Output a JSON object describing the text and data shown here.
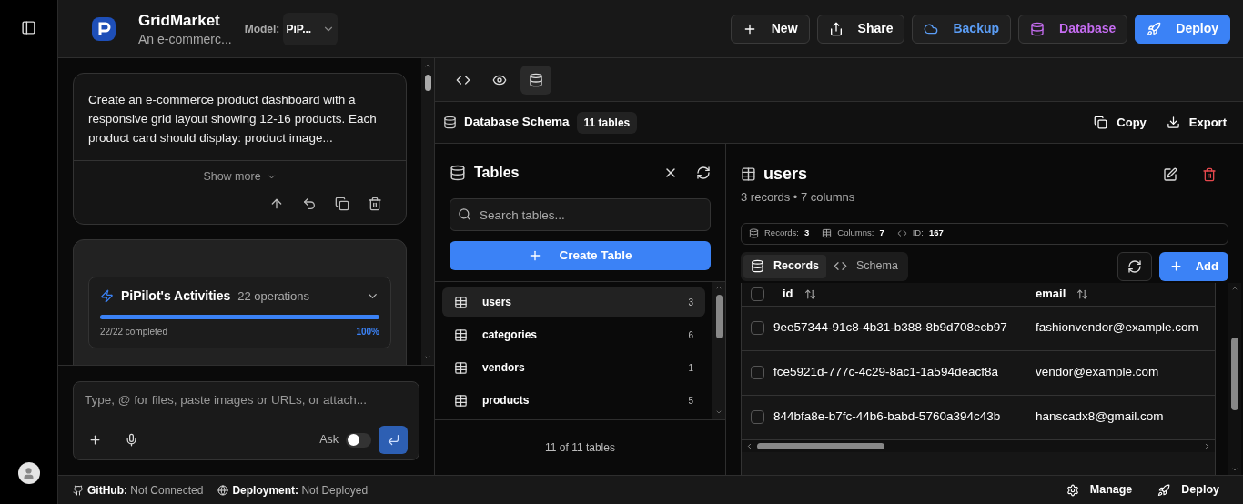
{
  "project": {
    "name": "GridMarket",
    "subtitle": "An e-commerc...",
    "model_label": "Model:",
    "model": "PiP..."
  },
  "header_buttons": [
    {
      "label": "New",
      "kind": "new"
    },
    {
      "label": "Share",
      "kind": "share"
    },
    {
      "label": "Backup",
      "kind": "backup"
    },
    {
      "label": "Database",
      "kind": "database"
    },
    {
      "label": "Deploy",
      "kind": "deploy"
    }
  ],
  "chat": {
    "message": "Create an e-commerce product dashboard with a responsive grid layout showing 12-16 products. Each product card should display: product image...",
    "show_more": "Show more",
    "activities": {
      "title": "PiPilot's Activities",
      "count": "22 operations",
      "progress": "22/22 completed",
      "percent": "100%",
      "level": 1
    }
  },
  "composer": {
    "placeholder": "Type, @ for files, paste images or URLs, or attach...",
    "mode_label": "Ask",
    "mode_on": false
  },
  "view_tabs": [
    {
      "kind": "code",
      "selected": false
    },
    {
      "kind": "preview",
      "selected": false
    },
    {
      "kind": "database",
      "selected": true
    }
  ],
  "schema": {
    "title": "Database Schema",
    "count": "11 tables",
    "actions": [
      {
        "label": "Copy",
        "kind": "copy"
      },
      {
        "label": "Export",
        "kind": "export"
      }
    ]
  },
  "tables_panel": {
    "title": "Tables",
    "search_placeholder": "Search tables...",
    "create": "Create Table",
    "items": [
      {
        "name": "users",
        "count": "3",
        "selected": true
      },
      {
        "name": "categories",
        "count": "6",
        "selected": false
      },
      {
        "name": "vendors",
        "count": "1",
        "selected": false
      },
      {
        "name": "products",
        "count": "5",
        "selected": false
      }
    ],
    "footer": "11 of 11 tables"
  },
  "detail": {
    "name": "users",
    "summary": "3 records • 7 columns",
    "stats": [
      {
        "label": "Records:",
        "value": "3",
        "kind": "records"
      },
      {
        "label": "Columns:",
        "value": "7",
        "kind": "columns"
      },
      {
        "label": "ID:",
        "value": "167",
        "kind": "id"
      }
    ],
    "tabs": [
      {
        "label": "Records",
        "kind": "records",
        "selected": true
      },
      {
        "label": "Schema",
        "kind": "schema",
        "selected": false
      }
    ],
    "add": "Add",
    "select_all_checked": false,
    "columns": [
      "id",
      "email"
    ],
    "rows": [
      {
        "id": "9ee57344-91c8-4b31-b388-8b9d708ecb97",
        "email": "fashionvendor@example.com",
        "checked": false
      },
      {
        "id": "fce5921d-777c-4c29-8ac1-1a594deacf8a",
        "email": "vendor@example.com",
        "checked": false
      },
      {
        "id": "844bfa8e-b7fc-44b6-babd-5760a394c43b",
        "email": "hanscadx8@gmail.com",
        "checked": false
      }
    ]
  },
  "status_bar": {
    "github_label": "GitHub:",
    "github": "Not Connected",
    "deployment_label": "Deployment:",
    "deployment": "Not Deployed",
    "actions": [
      {
        "label": "Manage",
        "kind": "manage"
      },
      {
        "label": "Deploy",
        "kind": "deploy"
      }
    ]
  }
}
